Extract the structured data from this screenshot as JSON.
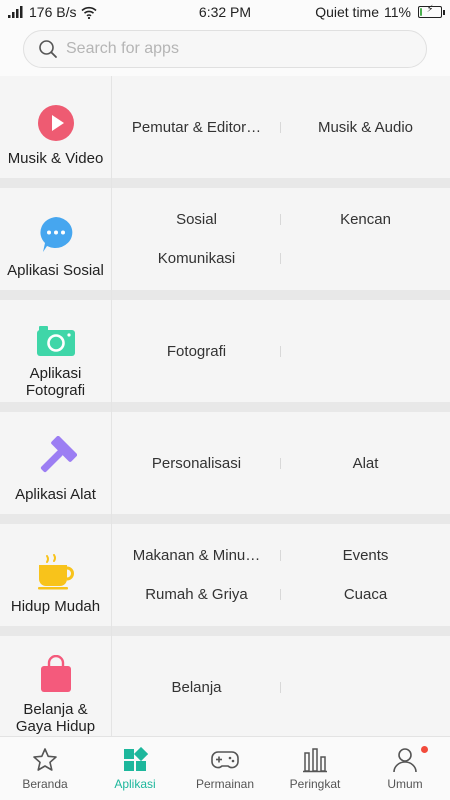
{
  "status_bar": {
    "speed": "176 B/s",
    "time": "6:32 PM",
    "mode": "Quiet time",
    "battery": "11%",
    "battery_level": 0.11
  },
  "search": {
    "placeholder": "Search for apps"
  },
  "categories": [
    {
      "name": "Musik & Video",
      "icon": "play-icon",
      "color": "#ee5b72",
      "subs": [
        "Pemutar & Editor…",
        "Musik & Audio"
      ]
    },
    {
      "name": "Aplikasi Sosial",
      "icon": "chat-bubble-icon",
      "color": "#46a6ef",
      "subs": [
        "Sosial",
        "Kencan",
        "Komunikasi",
        ""
      ]
    },
    {
      "name": "Aplikasi Fotografi",
      "icon": "camera-icon",
      "color": "#3fd6a8",
      "subs": [
        "Fotografi",
        ""
      ]
    },
    {
      "name": "Aplikasi Alat",
      "icon": "hammer-icon",
      "color": "#9c7ef3",
      "subs": [
        "Personalisasi",
        "Alat"
      ]
    },
    {
      "name": "Hidup Mudah",
      "icon": "coffee-cup-icon",
      "color": "#f8c31b",
      "subs": [
        "Makanan & Minu…",
        "Events",
        "Rumah & Griya",
        "Cuaca"
      ]
    },
    {
      "name": "Belanja & Gaya Hidup",
      "icon": "shopping-bag-icon",
      "color": "#f45a7c",
      "subs": [
        "Belanja",
        ""
      ]
    }
  ],
  "tabbar": {
    "active": "Aplikasi",
    "accent": "#1db79c",
    "items": [
      {
        "label": "Beranda",
        "icon": "star-icon"
      },
      {
        "label": "Aplikasi",
        "icon": "apps-grid-icon"
      },
      {
        "label": "Permainan",
        "icon": "gamepad-icon"
      },
      {
        "label": "Peringkat",
        "icon": "ranking-bars-icon"
      },
      {
        "label": "Umum",
        "icon": "profile-icon"
      }
    ]
  }
}
